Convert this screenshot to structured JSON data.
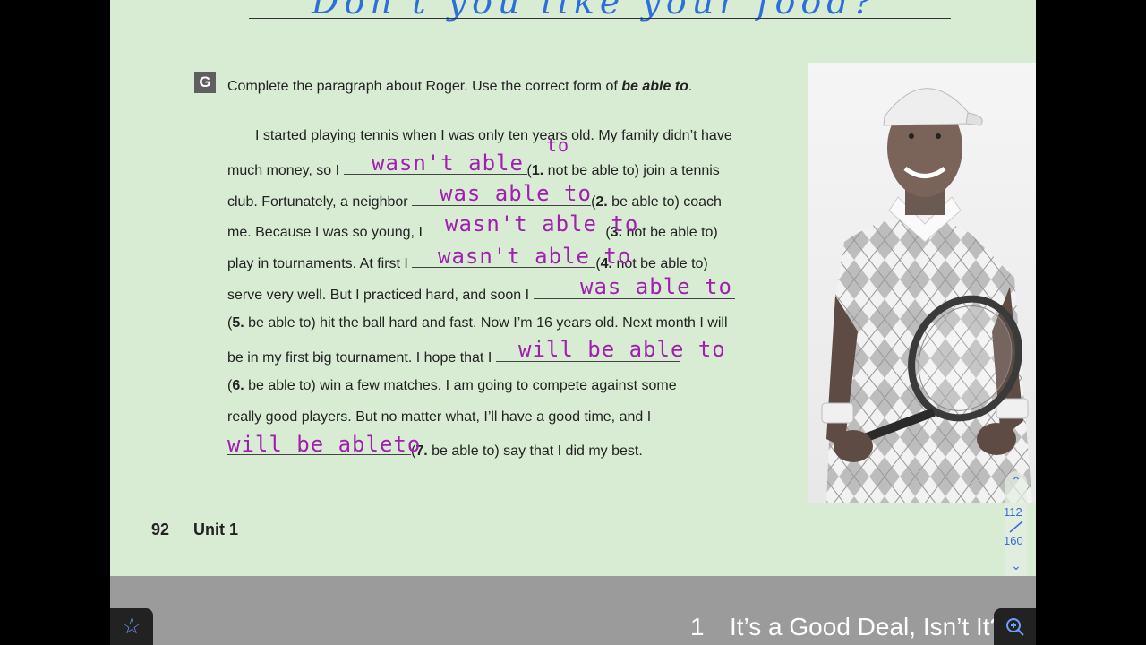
{
  "top_handwriting": "Don't you like your food?",
  "exercise": {
    "badge": "G",
    "instruction_prefix": "Complete the paragraph about Roger. Use the correct form of ",
    "instruction_bold": "be able to",
    "instruction_suffix": "."
  },
  "paragraph": {
    "l1": "I started playing tennis when I was only ten years old. My family didn’t have",
    "l2a": "much money, so I",
    "l2b": "(",
    "l2n": "1.",
    "l2c": " not be able to) join a tennis",
    "l3a": "club. Fortunately, a neighbor",
    "l3b": "(",
    "l3n": "2.",
    "l3c": " be able to) coach",
    "l4a": "me. Because I was so young, I",
    "l4b": "(",
    "l4n": "3.",
    "l4c": " not be able to)",
    "l5a": "play in tournaments. At first I",
    "l5b": "(",
    "l5n": "4.",
    "l5c": " not be able to)",
    "l6a": "serve very well. But I practiced hard, and soon I",
    "l7b": "(",
    "l7n": "5.",
    "l7c": " be able to) hit the ball hard and fast. Now I’m 16 years old. Next month I will",
    "l8a": "be in my first big tournament. I hope that I",
    "l9b": "(",
    "l9n": "6.",
    "l9c": " be able to) win a few matches. I am going to compete against some",
    "l10": "really good players. But no matter what, I’ll have a good time, and I",
    "l11b": "(",
    "l11n": "7.",
    "l11c": " be able to) say that I did my best."
  },
  "answers": {
    "a1": "wasn't able",
    "a1_extra": "to",
    "a2": "was able to",
    "a3": "wasn't able to",
    "a4": "wasn't able to",
    "a5": "was  able to",
    "a6": "will be  able to",
    "a7": "will be ableto"
  },
  "footer": {
    "page_number": "92",
    "unit": "Unit 1"
  },
  "bottom_bar": {
    "chapter_number": "1",
    "chapter_title": "It’s a Good Deal, Isn’t It?"
  },
  "page_indicator": {
    "current": "112",
    "total": "160"
  },
  "colors": {
    "page_bg": "#d8ecd3",
    "handwriting_purple": "#a11fb0",
    "handwriting_blue": "#2c6fd8",
    "accent_blue": "#3a6ad0"
  }
}
